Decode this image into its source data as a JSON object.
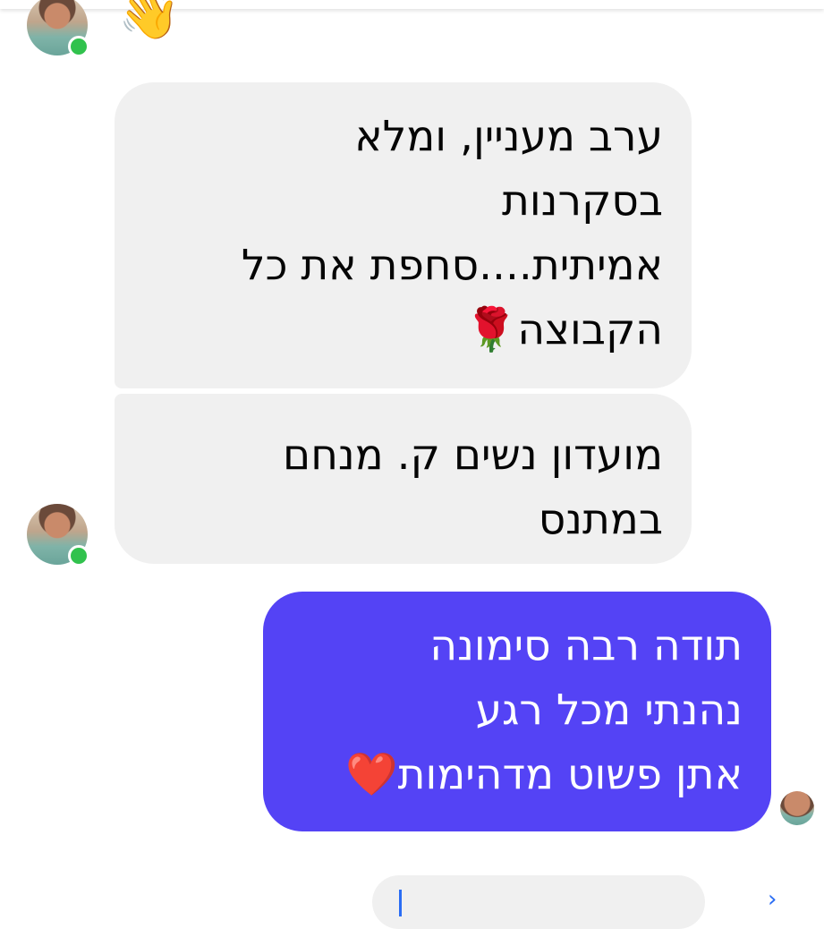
{
  "conversation": {
    "sender_avatar_icon": "user-avatar",
    "own_avatar_icon": "user-avatar-read-receipt",
    "online_status_color": "#31c24d",
    "wave_emoji": "👋",
    "messages": [
      {
        "direction": "incoming",
        "lines": [
          "ערב מעניין, ומלא",
          "בסקרנות",
          "אמיתית....סחפת את כל",
          "הקבוצה🌹"
        ]
      },
      {
        "direction": "incoming",
        "lines": [
          "מועדון נשים ק. מנחם",
          "במתנס"
        ]
      },
      {
        "direction": "outgoing",
        "lines": [
          "תודה רבה סימונה",
          "נהנתי מכל רגע",
          "אתן פשוט מדהימות❤️"
        ]
      }
    ]
  },
  "colors": {
    "incoming_bubble": "#f0f0f0",
    "outgoing_bubble": "#5443f5",
    "outgoing_text": "#ffffff"
  }
}
